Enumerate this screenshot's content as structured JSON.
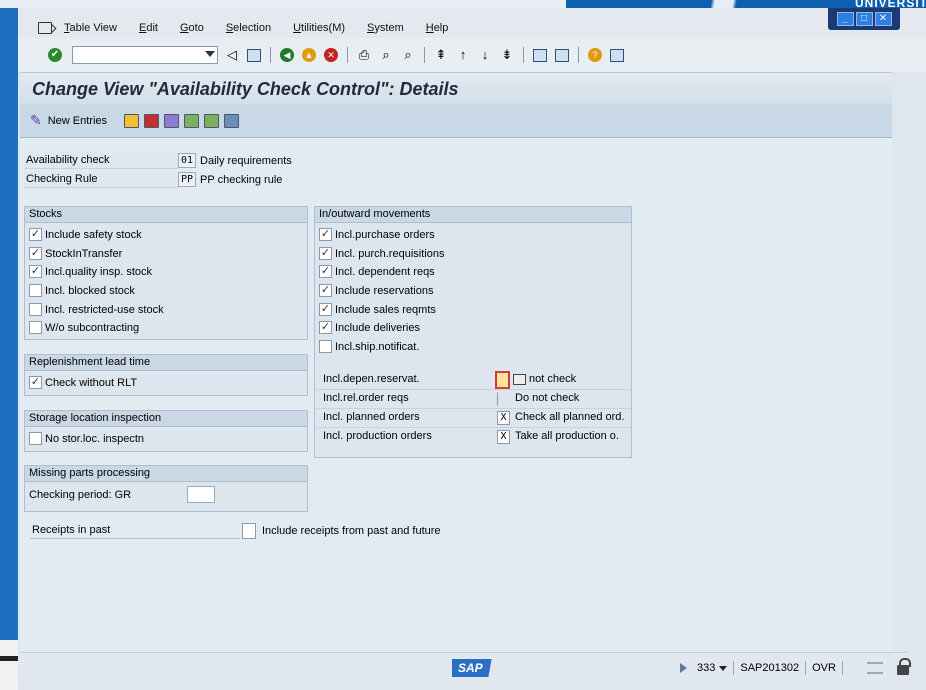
{
  "background": {
    "brand": "UNIVERSITÄT"
  },
  "menubar": {
    "items": [
      "Table View",
      "Edit",
      "Goto",
      "Selection",
      "Utilities(M)",
      "System",
      "Help"
    ]
  },
  "toolbar": {
    "command_value": ""
  },
  "header": {
    "title": "Change View \"Availability Check Control\": Details"
  },
  "apptoolbar": {
    "new_entries": "New Entries"
  },
  "fields": {
    "availability_check": {
      "label": "Availability check",
      "code": "01",
      "text": "Daily requirements"
    },
    "checking_rule": {
      "label": "Checking Rule",
      "code": "PP",
      "text": "PP checking rule"
    }
  },
  "stocks": {
    "title": "Stocks",
    "items": [
      {
        "label": "Include safety stock",
        "checked": true
      },
      {
        "label": "StockInTransfer",
        "checked": true
      },
      {
        "label": "Incl.quality insp. stock",
        "checked": true
      },
      {
        "label": "Incl. blocked stock",
        "checked": false
      },
      {
        "label": "Incl. restricted-use stock",
        "checked": false
      },
      {
        "label": "W/o subcontracting",
        "checked": false
      }
    ]
  },
  "replenishment": {
    "title": "Replenishment lead time",
    "items": [
      {
        "label": "Check without RLT",
        "checked": true
      }
    ]
  },
  "storage": {
    "title": "Storage location inspection",
    "items": [
      {
        "label": "No stor.loc. inspectn",
        "checked": false
      }
    ]
  },
  "missing_parts": {
    "title": "Missing parts processing",
    "label": "Checking period: GR",
    "value": ""
  },
  "receipts": {
    "label": "Receipts in past",
    "value_text": "Include receipts from past and future"
  },
  "movements": {
    "title": "In/outward movements",
    "items": [
      {
        "label": "Incl.purchase orders",
        "checked": true
      },
      {
        "label": "Incl. purch.requisitions",
        "checked": true
      },
      {
        "label": "Incl. dependent reqs",
        "checked": true
      },
      {
        "label": "Include reservations",
        "checked": true
      },
      {
        "label": "Include sales reqmts",
        "checked": true
      },
      {
        "label": "Include deliveries",
        "checked": true
      },
      {
        "label": "Incl.ship.notificat.",
        "checked": false
      }
    ],
    "rows": [
      {
        "label": "Incl.depen.reservat.",
        "code": "",
        "text": "not check"
      },
      {
        "label": "Incl.rel.order reqs",
        "code": "",
        "text": "Do not check"
      },
      {
        "label": "Incl. planned orders",
        "code": "X",
        "text": "Check all planned ord."
      },
      {
        "label": "Incl. production orders",
        "code": "X",
        "text": "Take all production o."
      }
    ]
  },
  "statusbar": {
    "logo": "SAP",
    "client": "333",
    "system": "SAP201302",
    "mode": "OVR"
  },
  "colors": {
    "accent": "#1e6fc0",
    "header_bg": "#d3dee9",
    "check": "#333333"
  }
}
